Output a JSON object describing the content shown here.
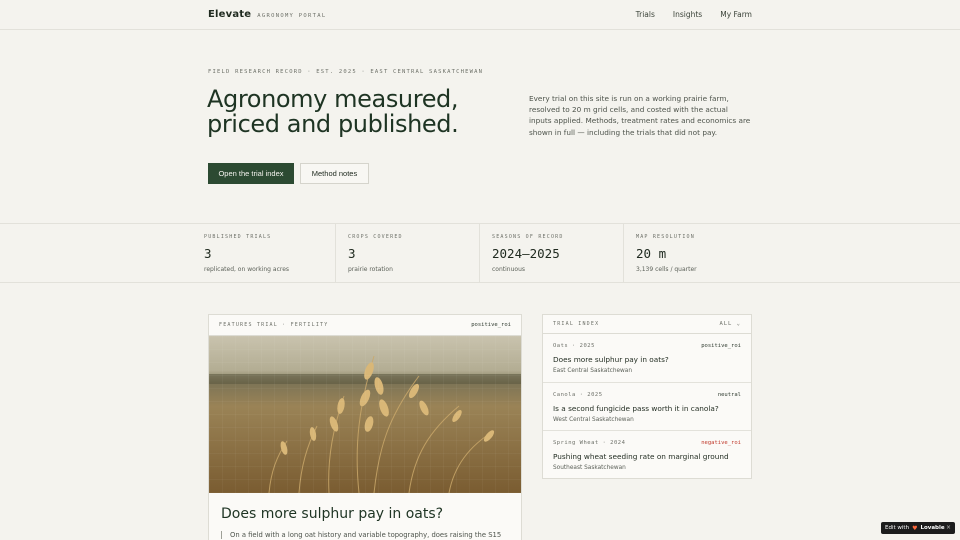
{
  "header": {
    "brand": "Elevate",
    "brand_sub": "AGRONOMY PORTAL",
    "nav": [
      "Trials",
      "Insights",
      "My Farm"
    ]
  },
  "hero": {
    "eyebrow": "FIELD RESEARCH RECORD · EST. 2025 · EAST CENTRAL SASKATCHEWAN",
    "title_line1": "Agronomy measured,",
    "title_line2": "priced and published.",
    "description": "Every trial on this site is run on a working prairie farm, resolved to 20 m grid cells, and costed with the actual inputs applied. Methods, treatment rates and economics are shown in full — including the trials that did not pay.",
    "primary_button": "Open the trial index",
    "secondary_button": "Method notes"
  },
  "stats": [
    {
      "label": "PUBLISHED TRIALS",
      "value": "3",
      "sub": "replicated, on working acres"
    },
    {
      "label": "CROPS COVERED",
      "value": "3",
      "sub": "prairie rotation"
    },
    {
      "label": "SEASONS OF RECORD",
      "value": "2024–2025",
      "sub": "continuous"
    },
    {
      "label": "MAP RESOLUTION",
      "value": "20 m",
      "sub": "3,139 cells / quarter"
    }
  ],
  "featured": {
    "tag": "FEATURES TRIAL · FERTILITY",
    "roi": "positive_roi",
    "title": "Does more sulphur pay in oats?",
    "excerpt": "On a field with a long oat history and variable topography, does raising the S15"
  },
  "index": {
    "title": "TRIAL INDEX",
    "filter": "ALL ⌄",
    "items": [
      {
        "meta": "Oats · 2025",
        "roi": "positive_roi",
        "title": "Does more sulphur pay in oats?",
        "region": "East Central Saskatchewan"
      },
      {
        "meta": "Canola · 2025",
        "roi": "neutral",
        "title": "Is a second fungicide pass worth it in canola?",
        "region": "West Central Saskatchewan"
      },
      {
        "meta": "Spring Wheat · 2024",
        "roi": "negative_roi",
        "title": "Pushing wheat seeding rate on marginal ground",
        "region": "Southeast Saskatchewan"
      }
    ]
  },
  "colors": {
    "accent": "#2c4a32",
    "positive": "#2f3b2f",
    "neutral": "#2f3b2f",
    "negative": "#c0392b"
  },
  "badge": {
    "prefix": "Edit with",
    "brand": "Lovable",
    "close": "×"
  }
}
